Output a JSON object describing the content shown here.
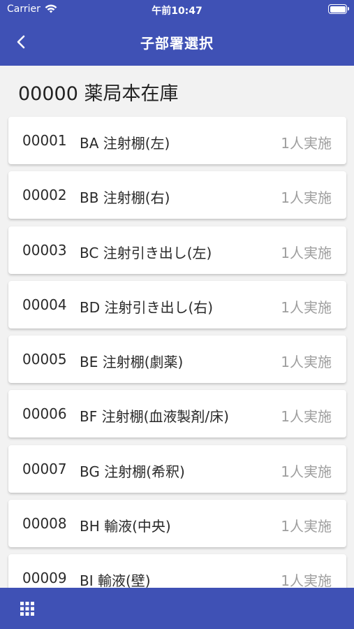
{
  "status_bar": {
    "carrier": "Carrier",
    "time": "午前10:47"
  },
  "nav": {
    "title": "子部署選択"
  },
  "section": {
    "title": "00000 薬局本在庫"
  },
  "items": [
    {
      "code": "00001",
      "name": "BA 注射棚(左)",
      "status": "1人実施"
    },
    {
      "code": "00002",
      "name": "BB 注射棚(右)",
      "status": "1人実施"
    },
    {
      "code": "00003",
      "name": "BC 注射引き出し(左)",
      "status": "1人実施"
    },
    {
      "code": "00004",
      "name": "BD 注射引き出し(右)",
      "status": "1人実施"
    },
    {
      "code": "00005",
      "name": "BE 注射棚(劇薬)",
      "status": "1人実施"
    },
    {
      "code": "00006",
      "name": "BF 注射棚(血液製剤/床)",
      "status": "1人実施"
    },
    {
      "code": "00007",
      "name": "BG 注射棚(希釈)",
      "status": "1人実施"
    },
    {
      "code": "00008",
      "name": "BH 輸液(中央)",
      "status": "1人実施"
    },
    {
      "code": "00009",
      "name": "BI 輸液(壁)",
      "status": "1人実施"
    }
  ],
  "colors": {
    "primary": "#3f51b5",
    "background": "#f2f2f2",
    "muted_text": "#9e9e9e"
  },
  "icons": {
    "back": "chevron-left-icon",
    "menu": "grid-icon",
    "wifi": "wifi-icon",
    "battery": "battery-icon"
  }
}
